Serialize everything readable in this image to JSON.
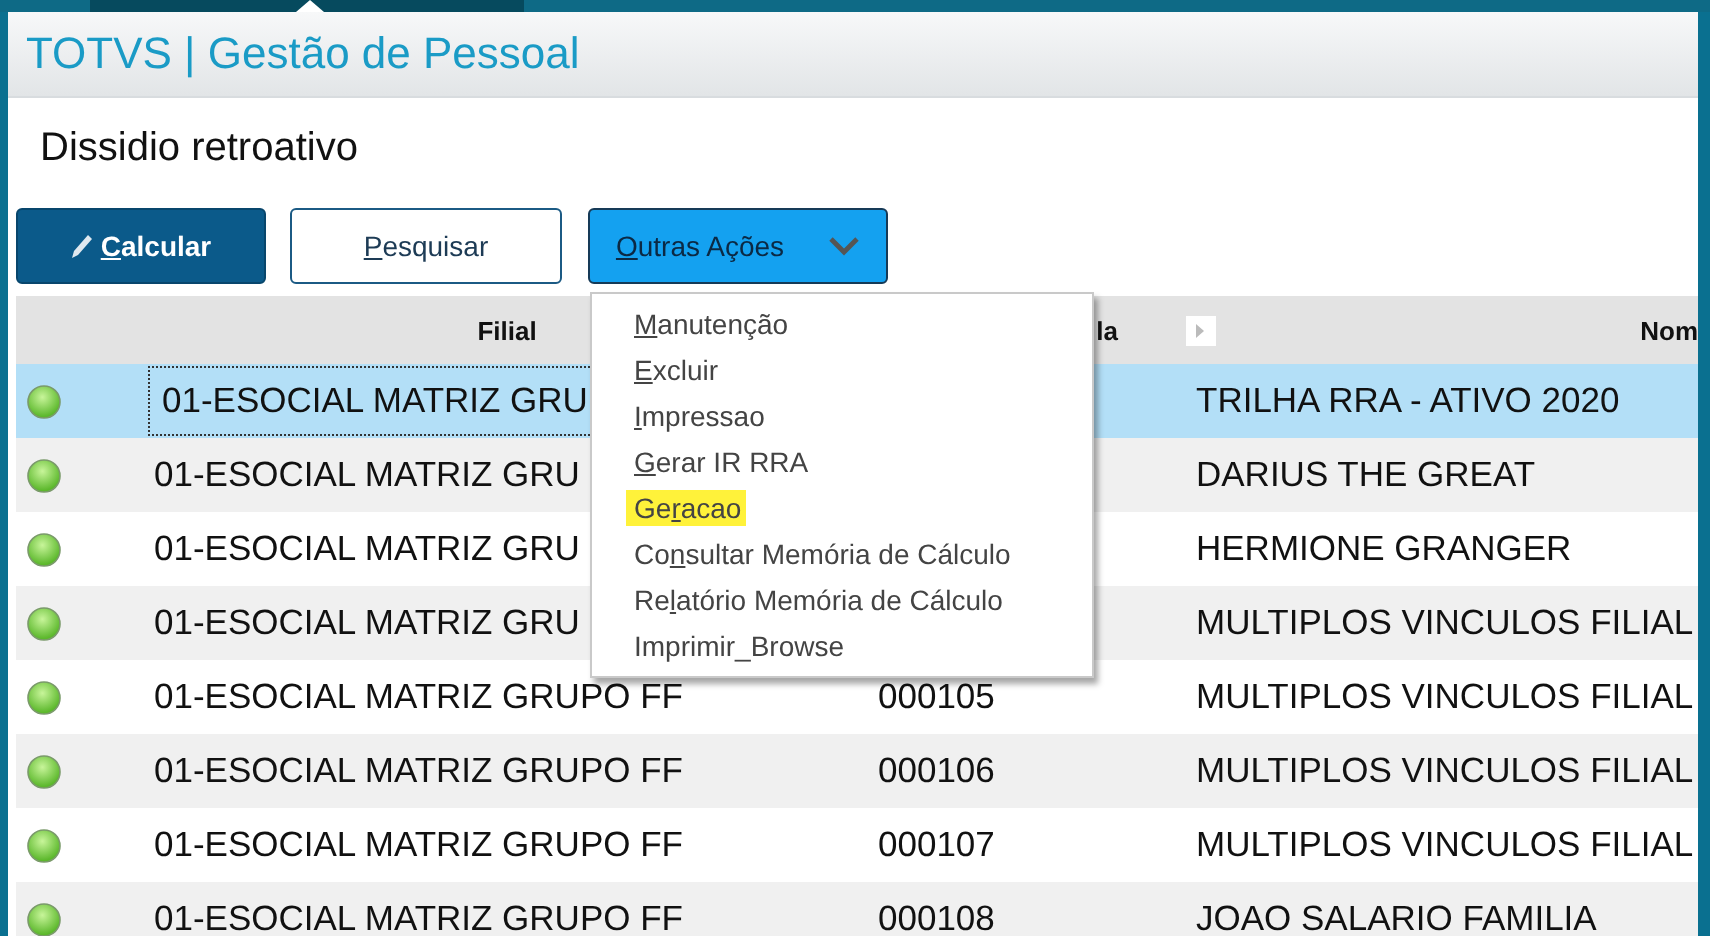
{
  "header": {
    "title": "TOTVS | Gestão de Pessoal"
  },
  "page": {
    "title": "Dissidio retroativo"
  },
  "buttons": [
    {
      "kind": "primary",
      "key": "C",
      "after": "alcular"
    },
    {
      "kind": "outline",
      "key": "P",
      "after": "esquisar"
    },
    {
      "kind": "dropdown",
      "key": "O",
      "after": "utras Ações"
    }
  ],
  "menu": {
    "items": [
      {
        "key": "M",
        "after": "anutenção",
        "highlighted": false
      },
      {
        "key": "E",
        "after": "xcluir",
        "highlighted": false
      },
      {
        "key": "I",
        "after": "mpressao",
        "highlighted": false
      },
      {
        "key": "G",
        "after": "erar IR RRA",
        "highlighted": false
      },
      {
        "before": "Ge",
        "key": "r",
        "after": "acao",
        "highlighted": true
      },
      {
        "before": "Co",
        "key": "n",
        "after": "sultar Memória de Cálculo",
        "highlighted": false
      },
      {
        "before": "Re",
        "key": "l",
        "after": "atório Memória de Cálculo",
        "highlighted": false
      },
      {
        "before": "Imprimir_Browse",
        "highlighted": false
      }
    ]
  },
  "table": {
    "columns": [
      "Filial",
      "la",
      "Nom"
    ],
    "rows": [
      {
        "selected": true,
        "filial": "01-ESOCIAL MATRIZ GRU",
        "nome": "TRILHA RRA - ATIVO 2020"
      },
      {
        "selected": false,
        "filial": "01-ESOCIAL MATRIZ GRU",
        "nome": "DARIUS THE GREAT"
      },
      {
        "selected": false,
        "filial": "01-ESOCIAL MATRIZ GRU",
        "nome": "HERMIONE GRANGER"
      },
      {
        "selected": false,
        "filial": "01-ESOCIAL MATRIZ GRU",
        "nome": "MULTIPLOS VINCULOS FILIAL"
      },
      {
        "selected": false,
        "filial": "01-ESOCIAL MATRIZ GRUPO FF",
        "matricula": "000105",
        "nome": "MULTIPLOS VINCULOS FILIAL"
      },
      {
        "selected": false,
        "filial": "01-ESOCIAL MATRIZ GRUPO FF",
        "matricula": "000106",
        "nome": "MULTIPLOS VINCULOS FILIAL"
      },
      {
        "selected": false,
        "filial": "01-ESOCIAL MATRIZ GRUPO FF",
        "matricula": "000107",
        "nome": "MULTIPLOS VINCULOS FILIAL"
      },
      {
        "selected": false,
        "filial": "01-ESOCIAL MATRIZ GRUPO FF",
        "matricula": "000108",
        "nome": "JOAO SALARIO FAMILIA"
      }
    ]
  }
}
